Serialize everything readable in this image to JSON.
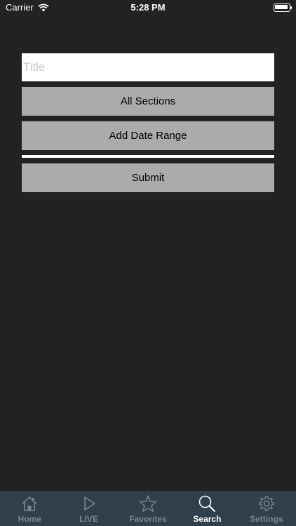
{
  "status_bar": {
    "carrier": "Carrier",
    "time": "5:28 PM"
  },
  "search_form": {
    "title_placeholder": "Title",
    "sections_label": "All Sections",
    "date_range_label": "Add Date Range",
    "submit_label": "Submit"
  },
  "tab_bar": {
    "active": "Search",
    "tabs": [
      {
        "label": "Home",
        "icon": "home-icon"
      },
      {
        "label": "LIVE",
        "icon": "play-icon"
      },
      {
        "label": "Favorites",
        "icon": "star-icon"
      },
      {
        "label": "Search",
        "icon": "search-icon"
      },
      {
        "label": "Settings",
        "icon": "gear-icon"
      }
    ]
  }
}
